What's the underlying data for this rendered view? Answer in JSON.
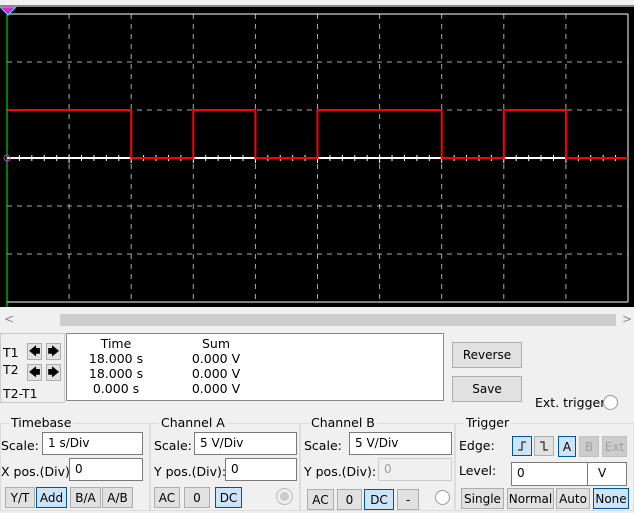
{
  "chart_data": {
    "type": "line",
    "xlim": [
      0,
      10
    ],
    "ylim": [
      -15,
      15
    ],
    "x_unit": "s",
    "y_unit": "V",
    "grid": true,
    "series": [
      {
        "color": "#ff0000",
        "x": [
          0,
          2,
          2,
          3,
          3,
          4,
          4,
          5,
          5,
          7,
          7,
          8,
          8,
          9,
          9,
          10
        ],
        "y": [
          5,
          5,
          0,
          0,
          5,
          5,
          0,
          0,
          5,
          5,
          0,
          0,
          5,
          5,
          0,
          0
        ]
      }
    ]
  },
  "colors": {
    "screen": "#000000",
    "trace": "#ff0000",
    "cursor1": "#00ff00",
    "grid": "#aaaaaa",
    "selected": "#cce4f7"
  },
  "scrollbar": {
    "left": "<",
    "right": ">"
  },
  "cursors": {
    "t1": "T1",
    "t2": "T2",
    "diff": "T2-T1",
    "left": "🡄",
    "right": "🡆"
  },
  "readout": {
    "headers": [
      "Time",
      "Sum"
    ],
    "rows": [
      [
        "18.000 s",
        "0.000 V"
      ],
      [
        "18.000 s",
        "0.000 V"
      ],
      [
        "0.000 s",
        "0.000 V"
      ]
    ]
  },
  "buttons": {
    "reverse": "Reverse",
    "save": "Save",
    "ext_trigger": "Ext. trigger"
  },
  "timebase": {
    "title": "Timebase",
    "scale_label": "Scale:",
    "scale": "1  s/Div",
    "xpos_label": "X pos.(Div):",
    "xpos": "0",
    "modes": [
      "Y/T",
      "Add",
      "B/A",
      "A/B"
    ],
    "active": "Add"
  },
  "channel_a": {
    "title": "Channel A",
    "scale_label": "Scale:",
    "scale": "5  V/Div",
    "ypos_label": "Y pos.(Div):",
    "ypos": "0",
    "coupling": [
      "AC",
      "0",
      "DC"
    ],
    "active": "DC"
  },
  "channel_b": {
    "title": "Channel B",
    "scale_label": "Scale:",
    "scale": "5  V/Div",
    "ypos_label": "Y pos.(Div):",
    "ypos": "0",
    "coupling": [
      "AC",
      "0",
      "DC",
      "-"
    ],
    "active": "DC"
  },
  "trigger": {
    "title": "Trigger",
    "edge_label": "Edge:",
    "edges": [
      "rising-edge-icon",
      "falling-edge-icon"
    ],
    "sources": [
      "A",
      "B",
      "Ext"
    ],
    "active_source": "A",
    "level_label": "Level:",
    "level": "0",
    "level_unit": "V",
    "modes": [
      "Single",
      "Normal",
      "Auto",
      "None"
    ],
    "active_mode": "None"
  }
}
